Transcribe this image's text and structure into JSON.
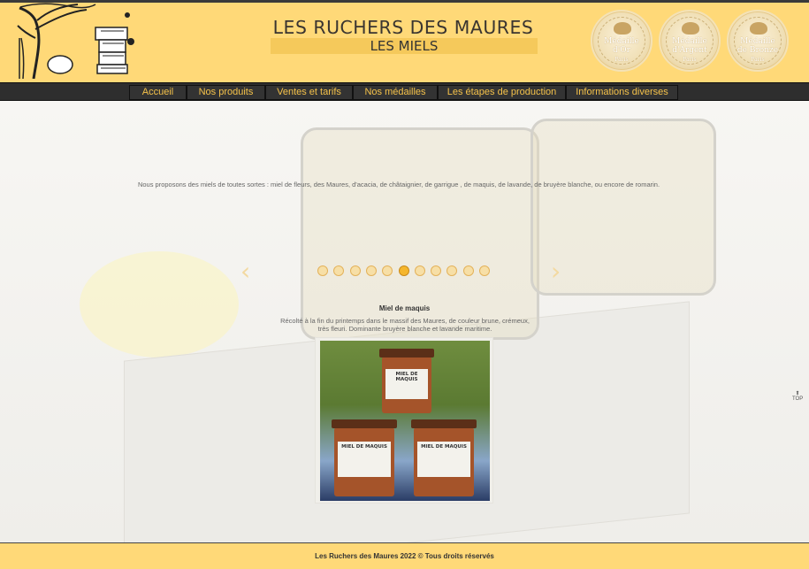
{
  "header": {
    "brand": "LES RUCHERS DES MAURES",
    "page_title": "LES MIELS",
    "medals": [
      {
        "line1": "Médaille",
        "line2": "d'Or",
        "line3": "Paris",
        "icon": "gold-medal-icon"
      },
      {
        "line1": "Médaille",
        "line2": "d'Argent",
        "line3": "Paris",
        "icon": "silver-medal-icon"
      },
      {
        "line1": "Médaille",
        "line2": "de Bronze",
        "line3": "Paris",
        "icon": "bronze-medal-icon"
      }
    ]
  },
  "nav": {
    "items": [
      {
        "label": "Accueil"
      },
      {
        "label": "Nos produits"
      },
      {
        "label": "Ventes et tarifs"
      },
      {
        "label": "Nos médailles"
      },
      {
        "label": "Les étapes de production"
      },
      {
        "label": "Informations diverses"
      }
    ]
  },
  "main": {
    "intro": "Nous proposons des miels de toutes sortes : miel de fleurs, des Maures, d'acacia, de châtaignier, de garrigue , de maquis, de lavande, de bruyère blanche, ou encore de romarin.",
    "slider": {
      "prev_icon": "‹",
      "next_icon": "›",
      "dot_count": 11,
      "active_dot": 6,
      "slide_title": "Miel de maquis",
      "slide_desc": "Récolté à la fin du printemps dans le massif des Maures, de couleur brune, crémeux, très fleuri. Dominante bruyère blanche et lavande maritime.",
      "jar_label": "MIEL DE MAQUIS"
    },
    "top_link": "TOP"
  },
  "footer": {
    "text": "Les Ruchers des Maures 2022 © Tous droits réservés"
  },
  "colors": {
    "header_bg": "#ffd978",
    "nav_bg": "#2e2e2e",
    "nav_text": "#f5c24a",
    "accent": "#f5b62c"
  }
}
